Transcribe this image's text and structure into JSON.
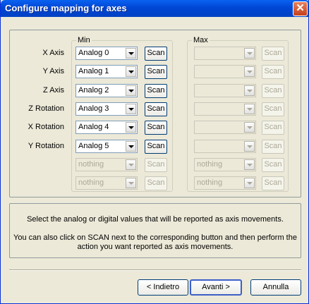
{
  "window": {
    "title": "Configure mapping for axes",
    "close_glyph": "✕"
  },
  "min_label": "Min",
  "max_label": "Max",
  "scan_label": "Scan",
  "rows": [
    {
      "label": "X Axis",
      "min": "Analog 0",
      "max": ""
    },
    {
      "label": "Y Axis",
      "min": "Analog 1",
      "max": ""
    },
    {
      "label": "Z Axis",
      "min": "Analog 2",
      "max": ""
    },
    {
      "label": "Z Rotation",
      "min": "Analog 3",
      "max": ""
    },
    {
      "label": "X Rotation",
      "min": "Analog 4",
      "max": ""
    },
    {
      "label": "Y Rotation",
      "min": "Analog 5",
      "max": ""
    },
    {
      "label": "",
      "min": "nothing",
      "max": "nothing"
    },
    {
      "label": "",
      "min": "nothing",
      "max": "nothing"
    }
  ],
  "info": {
    "line1": "Select the analog or digital values that will be reported as axis movements.",
    "line2": "You can also click on SCAN next to the corresponding button and then perform the action you want reported as axis movements."
  },
  "buttons": {
    "back": "< Indietro",
    "next": "Avanti >",
    "cancel": "Annulla"
  }
}
